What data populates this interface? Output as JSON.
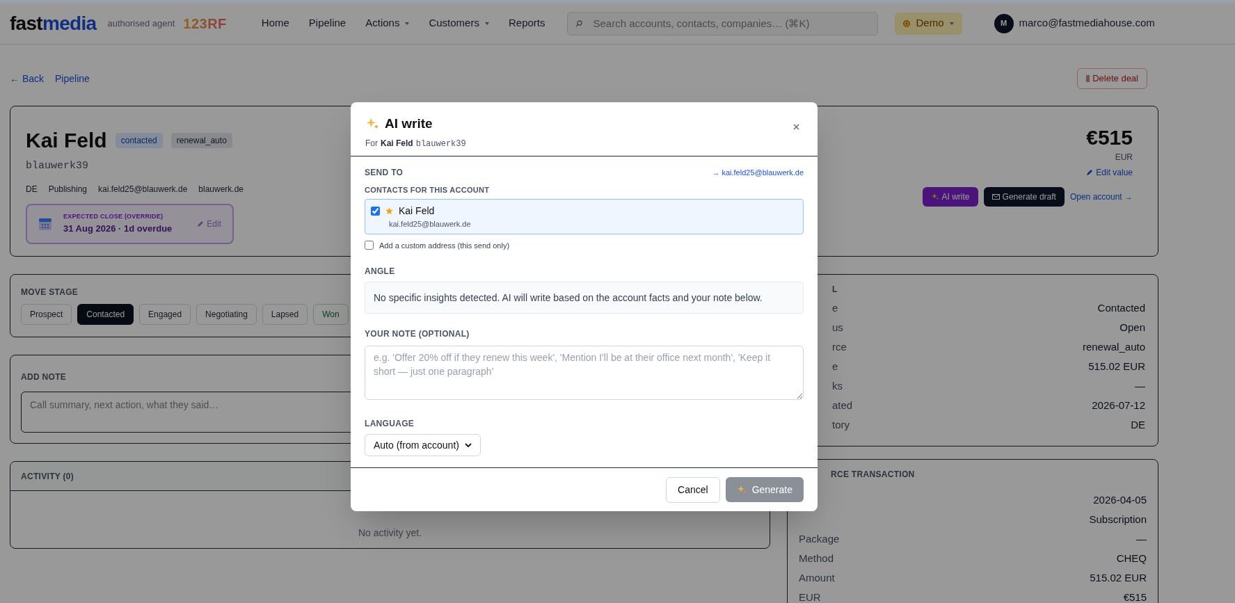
{
  "header": {
    "logo": {
      "part1": "fast",
      "part2": "media"
    },
    "agent_label": "authorised agent",
    "agent_logo": "123RF",
    "nav": [
      {
        "label": "Home",
        "has_menu": false
      },
      {
        "label": "Pipeline",
        "has_menu": false
      },
      {
        "label": "Actions",
        "has_menu": true
      },
      {
        "label": "Customers",
        "has_menu": true
      },
      {
        "label": "Reports",
        "has_menu": false
      }
    ],
    "search": {
      "placeholder": "Search accounts, contacts, companies… (⌘K)"
    },
    "mode": {
      "label": "Demo"
    },
    "user": {
      "initial": "M",
      "email": "marco@fastmediahouse.com"
    }
  },
  "breadcrumb": {
    "back": "← Back",
    "current": "Pipeline"
  },
  "delete_button": "Delete deal",
  "deal": {
    "name": "Kai Feld",
    "tags": [
      {
        "label": "contacted",
        "kind": "status"
      },
      {
        "label": "renewal_auto",
        "kind": "source"
      }
    ],
    "handle": "blauwerk39",
    "facts": [
      "DE",
      "Publishing",
      "kai.feld25@blauwerk.de",
      "blauwerk.de"
    ],
    "expected_close": {
      "label": "EXPECTED CLOSE (OVERRIDE)",
      "value": "31 Aug 2026 · 1d overdue",
      "edit": "Edit"
    },
    "amount": "€515",
    "currency": "EUR",
    "edit_value": "Edit value",
    "actions": {
      "ai_write": "AI write",
      "generate_draft": "Generate draft",
      "open_account": "Open account →"
    }
  },
  "move_stage": {
    "title": "MOVE STAGE",
    "stages": [
      {
        "label": "Prospect",
        "selected": false,
        "kind": "normal"
      },
      {
        "label": "Contacted",
        "selected": true,
        "kind": "normal"
      },
      {
        "label": "Engaged",
        "selected": false,
        "kind": "normal"
      },
      {
        "label": "Negotiating",
        "selected": false,
        "kind": "normal"
      },
      {
        "label": "Lapsed",
        "selected": false,
        "kind": "normal"
      },
      {
        "label": "Won",
        "selected": false,
        "kind": "won"
      }
    ]
  },
  "add_note": {
    "title": "ADD NOTE",
    "placeholder": "Call summary, next action, what they said…"
  },
  "activity": {
    "title": "ACTIVITY (0)",
    "empty": "No activity yet."
  },
  "deal_panel": {
    "title": "L",
    "rows": [
      {
        "label": "e",
        "value": "Contacted"
      },
      {
        "label": "us",
        "value": "Open"
      },
      {
        "label": "rce",
        "value": "renewal_auto"
      },
      {
        "label": "e",
        "value": "515.02 EUR"
      },
      {
        "label": "ks",
        "value": "—"
      },
      {
        "label": "ated",
        "value": "2026-07-12"
      },
      {
        "label": "tory",
        "value": "DE"
      }
    ]
  },
  "source_transaction": {
    "title": "RCE TRANSACTION",
    "rows": [
      {
        "value": "2026-04-05"
      },
      {
        "value": "Subscription"
      },
      {
        "label": "Package",
        "value": "—"
      },
      {
        "label": "Method",
        "value": "CHEQ"
      },
      {
        "label": "Amount",
        "value": "515.02 EUR"
      },
      {
        "label": "EUR",
        "value": "€515"
      }
    ]
  },
  "modal": {
    "title": "AI write",
    "subtitle_prefix": "For",
    "subtitle_name": "Kai Feld",
    "subtitle_handle": "blauwerk39",
    "send_to": {
      "label": "SEND TO",
      "recipient": "→ kai.feld25@blauwerk.de"
    },
    "contacts": {
      "label": "CONTACTS FOR THIS ACCOUNT",
      "items": [
        {
          "name": "Kai Feld",
          "email": "kai.feld25@blauwerk.de",
          "checked": true,
          "primary": true
        }
      ]
    },
    "custom_address": {
      "label": "Add a custom address (this send only)",
      "checked": false
    },
    "angle": {
      "label": "ANGLE",
      "text": "No specific insights detected. AI will write based on the account facts and your note below."
    },
    "note": {
      "label": "YOUR NOTE (OPTIONAL)",
      "placeholder": "e.g. 'Offer 20% off if they renew this week', 'Mention I'll be at their office next month', 'Keep it short — just one paragraph'"
    },
    "language": {
      "label": "LANGUAGE",
      "value": "Auto (from account)"
    },
    "cancel": "Cancel",
    "generate": {
      "label": "Generate",
      "disabled": true
    }
  }
}
